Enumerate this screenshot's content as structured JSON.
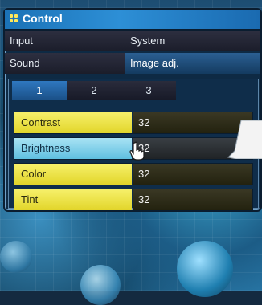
{
  "window": {
    "title": "Control"
  },
  "menu": {
    "items": [
      {
        "label": "Input"
      },
      {
        "label": "System"
      },
      {
        "label": "Sound"
      },
      {
        "label": "Image adj."
      }
    ]
  },
  "subtabs": [
    {
      "label": "1"
    },
    {
      "label": "2"
    },
    {
      "label": "3"
    }
  ],
  "settings": [
    {
      "label": "Contrast",
      "value": "32"
    },
    {
      "label": "Brightness",
      "value": "32"
    },
    {
      "label": "Color",
      "value": "32"
    },
    {
      "label": "Tint",
      "value": "32"
    }
  ],
  "colors": {
    "title_bar": "#2d8fd6",
    "row_yellow": "#f6f06a",
    "row_highlight": "#5fbfe0",
    "selected_tab": "#2b5f92"
  },
  "icons": [
    "grid-dots-icon",
    "hand-pointer-icon"
  ]
}
